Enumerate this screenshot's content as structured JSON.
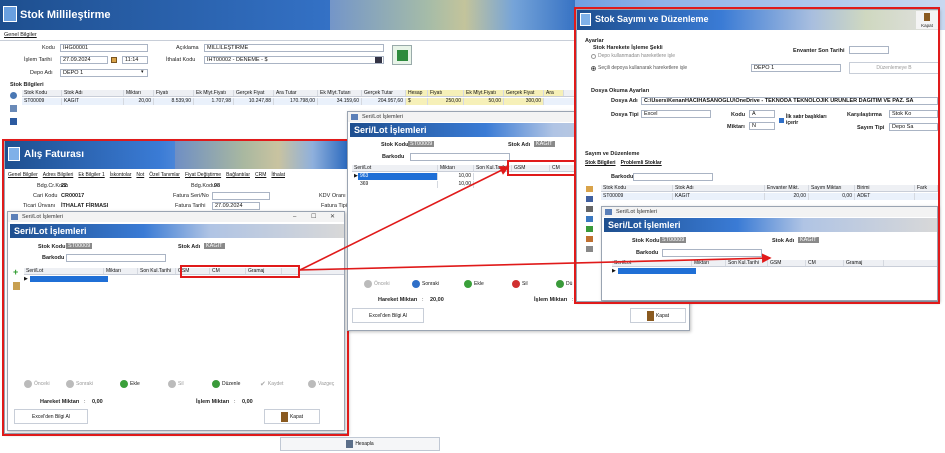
{
  "main": {
    "title": "Stok Millileştirme",
    "section_label": "Genel Bilgiler",
    "kod_label": "Kodu",
    "kod_value": "IHG00001",
    "islem_tarihi_label": "İşlem Tarihi",
    "islem_tarihi_value": "27.09.2024",
    "islem_saat_value": "11:14",
    "depo_label": "Depo Adı",
    "depo_value": "DEPO 1",
    "aciklama_label": "Açıklama",
    "aciklama_value": "MİLLİLEŞTİRME",
    "ithalat_label": "İthalat Kodu",
    "ithalat_value": "IHT00002 - DENEME - $",
    "stok_bilgileri_label": "Stok Bilgileri",
    "grid_headers": [
      "Stok Kodu",
      "Stok Adı",
      "Miktarı",
      "Fiyatı",
      "Ek Mlyt.Fiyatı",
      "Gerçek Fiyat",
      "Ara Tutar",
      "Ek Mlyt.Tutarı",
      "Gerçek Tutar",
      "Hesap",
      "Fiyatı",
      "Ek Mlyt.Fiyatı",
      "Gerçek Fiyat",
      "Ara"
    ],
    "grid_row": [
      "ST00009",
      "KAĞIT",
      "20,00",
      "8.539,90",
      "1.707,98",
      "10.247,88",
      "170.798,00",
      "34.159,60",
      "204.957,60",
      "$",
      "250,00",
      "50,00",
      "300,00"
    ],
    "hesapla_label": "Hesapla"
  },
  "alis": {
    "title": "Alış Faturası",
    "tabs": [
      "Genel Bilgiler",
      "Adres Bilgileri",
      "Ek Bilgiler 1",
      "İskontolar",
      "Not",
      "Özel Tanımlar",
      "Fiyat Değiştirme",
      "Bağlantılar",
      "CRM",
      "İthalat"
    ],
    "bdg_cr_kodu_label": "Bdg.Cr.Kodu",
    "bdg_cr_kodu_value": "22",
    "cari_kodu_label": "Cari Kodu",
    "cari_kodu_value": "CR00017",
    "ticari_unvani_label": "Ticari Ünvanı",
    "ticari_unvani_value": "İTHALAT FİRMASI",
    "bdg_kodu_label": "Bdg.Kodu",
    "bdg_kodu_value": "98",
    "fatura_seri_label": "Fatura Seri/No",
    "fatura_tarihi_label": "Fatura Tarihi",
    "fatura_tarihi_value": "27.09.2024",
    "kdv_label": "KDV Oranı",
    "fatura_tipi_label": "Fatura Tipi"
  },
  "serilot_left": {
    "window_title": "Seri/Lot İşlemleri",
    "title": "Seri/Lot İşlemleri",
    "stok_kodu_label": "Stok Kodu",
    "stok_kodu_value": "ST00009",
    "stok_adi_label": "Stok Adı",
    "stok_adi_value": "KAĞIT",
    "barkodu_label": "Barkodu",
    "headers": [
      "Seri/Lot",
      "Miktarı",
      "Son Kul.Tarihi",
      "GSM",
      "CM",
      "Gramaj"
    ],
    "buttons": [
      "Önceki",
      "Sonraki",
      "Ekle",
      "Sil",
      "Düzenle",
      "Kaydet",
      "Vazgeç"
    ],
    "hareket_label": "Hareket Miktarı",
    "hareket_value": "0,00",
    "islem_label": "İşlem Miktarı",
    "islem_value": "0,00",
    "excel_label": "Excel'den Bilgi Al",
    "kapat_label": "Kapat"
  },
  "serilot_mid": {
    "window_title": "Seri/Lot İşlemleri",
    "title": "Seri/Lot İşlemleri",
    "stok_kodu_label": "Stok Kodu",
    "stok_kodu_value": "ST00009",
    "stok_adi_label": "Stok Adı",
    "stok_adi_value": "KAĞIT",
    "barkodu_label": "Barkodu",
    "headers": [
      "Seri/Lot",
      "Miktarı",
      "Son Kul.Tarihi",
      "GSM",
      "CM"
    ],
    "rows": [
      [
        "963",
        "10,00"
      ],
      [
        "369",
        "10,00"
      ]
    ],
    "buttons": [
      "Önceki",
      "Sonraki",
      "Ekle",
      "Sil",
      "Dü"
    ],
    "hareket_label": "Hareket Miktarı",
    "hareket_value": "20,00",
    "islem_label": "İşlem Miktarı",
    "excel_label": "Excel'den Bilgi Al",
    "kapat_label": "Kapat"
  },
  "sayim": {
    "title": "Stok Sayımı ve Düzenleme",
    "kapat_label": "Kapat",
    "ayarlar_label": "Ayarlar",
    "hareket_sekli_label": "Stok Harekete İşleme Şekli",
    "radio1": "Depo kullanmadan hareketlere işle",
    "radio2": "Seçili depoya kullanarak hareketlere işle",
    "envanter_label": "Envanter Son Tarihi",
    "depo_value": "DEPO 1",
    "duzenlemeye_label": "Düzenlemeye B",
    "dosya_ayarlari_label": "Dosya Okuma Ayarları",
    "dosya_adi_label": "Dosya Adı",
    "dosya_adi_value": "C:\\Users\\KenanHACIHASANOĞLU\\OneDrive - TEKNODA TEKNOLOJIK URUNLER DAĞITIM VE PAZ. SA",
    "dosya_tipi_label": "Dosya Tipi",
    "dosya_tipi_value": "Excel",
    "kodu_label": "Kodu",
    "kodu_value": "A",
    "miktari_label": "Miktarı",
    "miktari_value": "N",
    "ilk_satir_label": "İlk satır başlıkları içerir",
    "karsilastirma_label": "Karşılaştırma",
    "karsilastirma_value": "Stok Ko",
    "sayim_tipi_label": "Sayım Tipi",
    "sayim_tipi_value": "Depo Sa",
    "sayim_duzenleme_label": "Sayım ve Düzenleme",
    "tab1": "Stok Bilgileri",
    "tab2": "Problemli Stoklar",
    "barkodu_label": "Barkodu",
    "headers": [
      "Stok Kodu",
      "Stok Adı",
      "Envanter Mikt.",
      "Sayım Miktarı",
      "Birimi",
      "Fark"
    ],
    "row": [
      "ST00009",
      "KAĞIT",
      "20,00",
      "0,00",
      "ADET"
    ],
    "serilot_window_title": "Seri/Lot İşlemleri",
    "serilot_title": "Seri/Lot İşlemleri",
    "serilot_stok_kodu_label": "Stok Kodu",
    "serilot_stok_kodu_value": "ST00009",
    "serilot_stok_adi_label": "Stok Adı",
    "serilot_stok_adi_value": "KAĞIT",
    "serilot_barkodu_label": "Barkodu",
    "serilot_headers": [
      "Seri/Lot",
      "Miktarı",
      "Son Kul.Tarihi",
      "GSM",
      "CM",
      "Gramaj"
    ]
  },
  "colors": {
    "highlight": "#e01a1a",
    "banner": "#1e4f8f",
    "selection": "#1f6fd6"
  }
}
